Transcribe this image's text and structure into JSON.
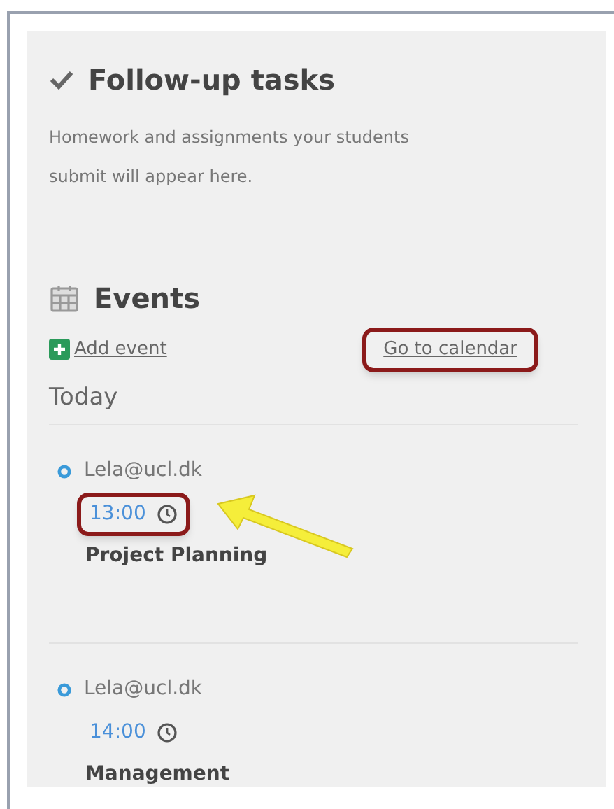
{
  "follow_up": {
    "title": "Follow-up tasks",
    "description": "Homework and assignments your students submit will appear here."
  },
  "events": {
    "title": "Events",
    "add_event": "Add event",
    "calendar_link": {
      "label": "Go to calendar",
      "highlighted": true
    },
    "day": "Today",
    "items": [
      {
        "owner": "Lela@ucl.dk",
        "time": "13:00",
        "title": "Project Planning",
        "highlighted": true
      },
      {
        "owner": "Lela@ucl.dk",
        "time": "14:00",
        "title": "Management",
        "highlighted": false
      }
    ]
  }
}
